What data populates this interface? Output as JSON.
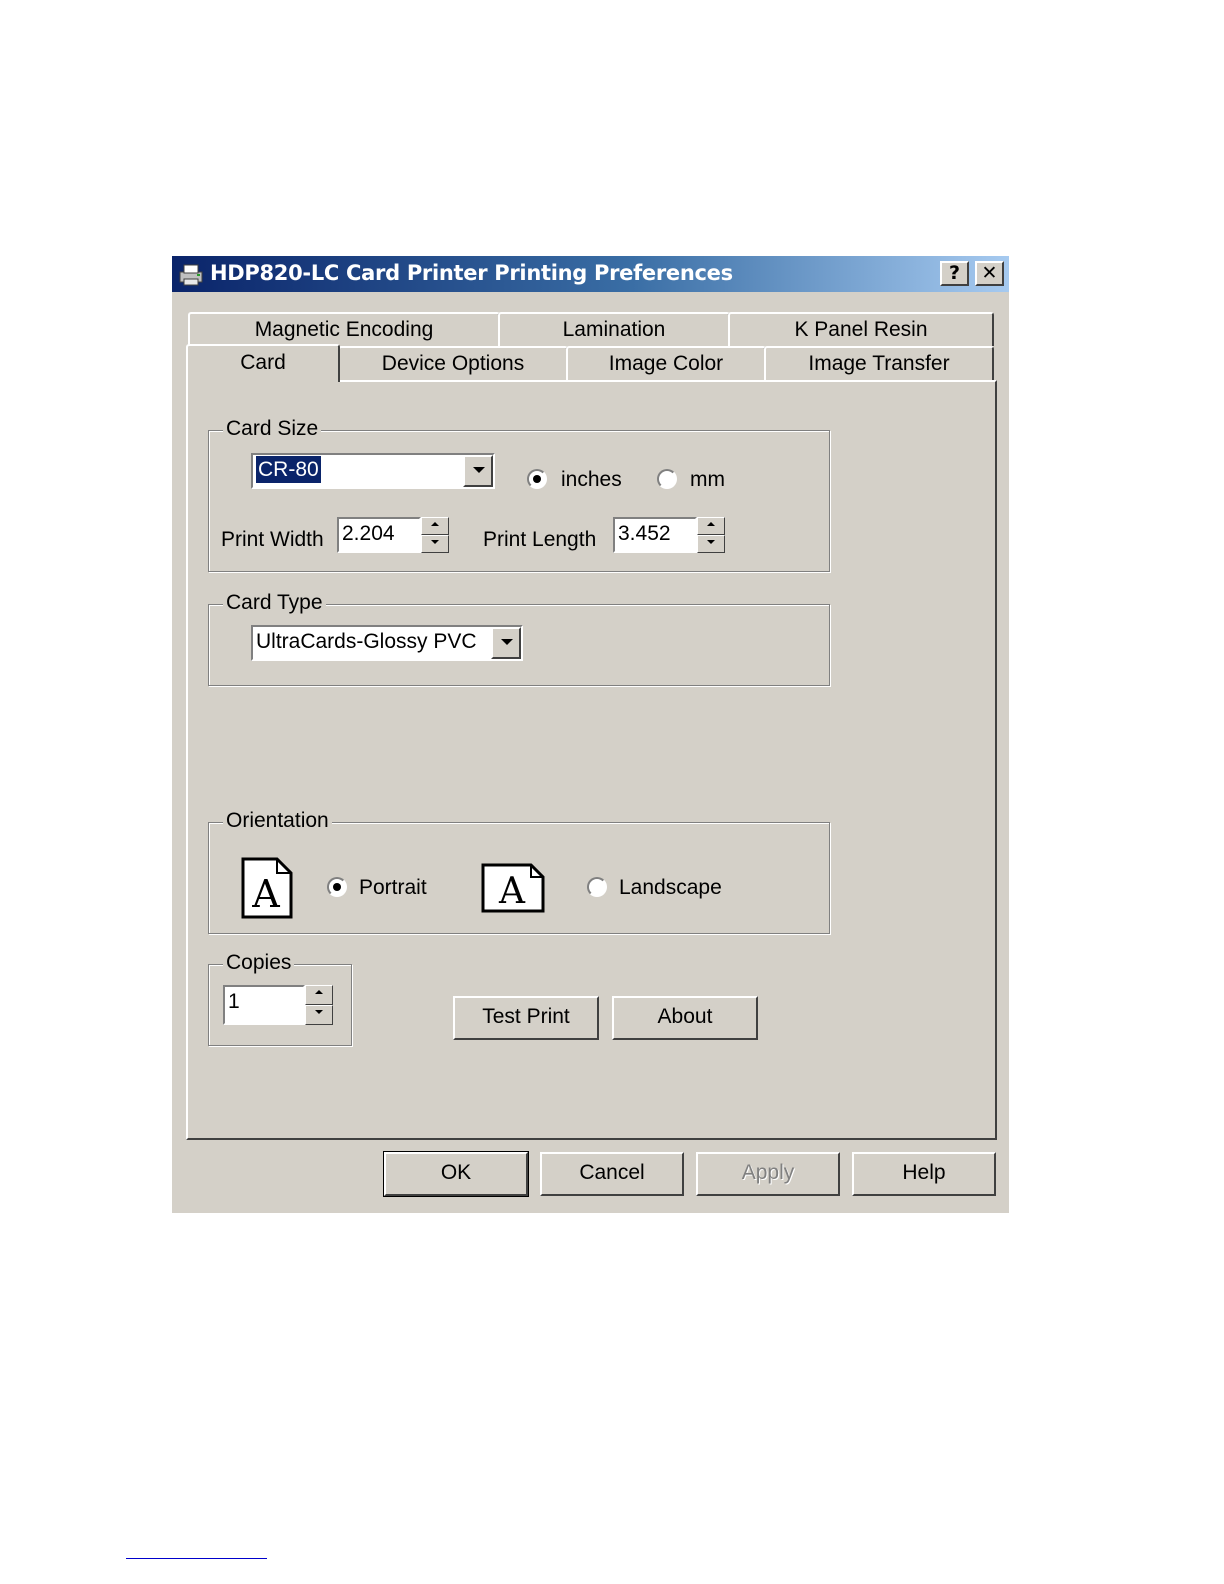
{
  "window": {
    "title": "HDP820-LC Card Printer Printing Preferences",
    "help_button": "?",
    "close_button": "✕"
  },
  "tabs": {
    "row_back": [
      "Magnetic Encoding",
      "Lamination",
      "K Panel Resin"
    ],
    "row_front": [
      "Card",
      "Device Options",
      "Image Color",
      "Image Transfer"
    ],
    "active": "Card"
  },
  "card_size": {
    "group_label": "Card Size",
    "size_value": "CR-80",
    "units": [
      {
        "label": "inches",
        "selected": true
      },
      {
        "label": "mm",
        "selected": false
      }
    ],
    "print_width_label": "Print Width",
    "print_width_value": "2.204",
    "print_length_label": "Print Length",
    "print_length_value": "3.452"
  },
  "card_type": {
    "group_label": "Card Type",
    "value": "UltraCards-Glossy PVC"
  },
  "orientation": {
    "group_label": "Orientation",
    "icon_letter": "A",
    "options": [
      {
        "label": "Portrait",
        "selected": true
      },
      {
        "label": "Landscape",
        "selected": false
      }
    ]
  },
  "copies": {
    "group_label": "Copies",
    "value": "1"
  },
  "panel_buttons": {
    "test_print": "Test Print",
    "about": "About"
  },
  "dialog_buttons": {
    "ok": "OK",
    "cancel": "Cancel",
    "apply": "Apply",
    "help": "Help"
  }
}
